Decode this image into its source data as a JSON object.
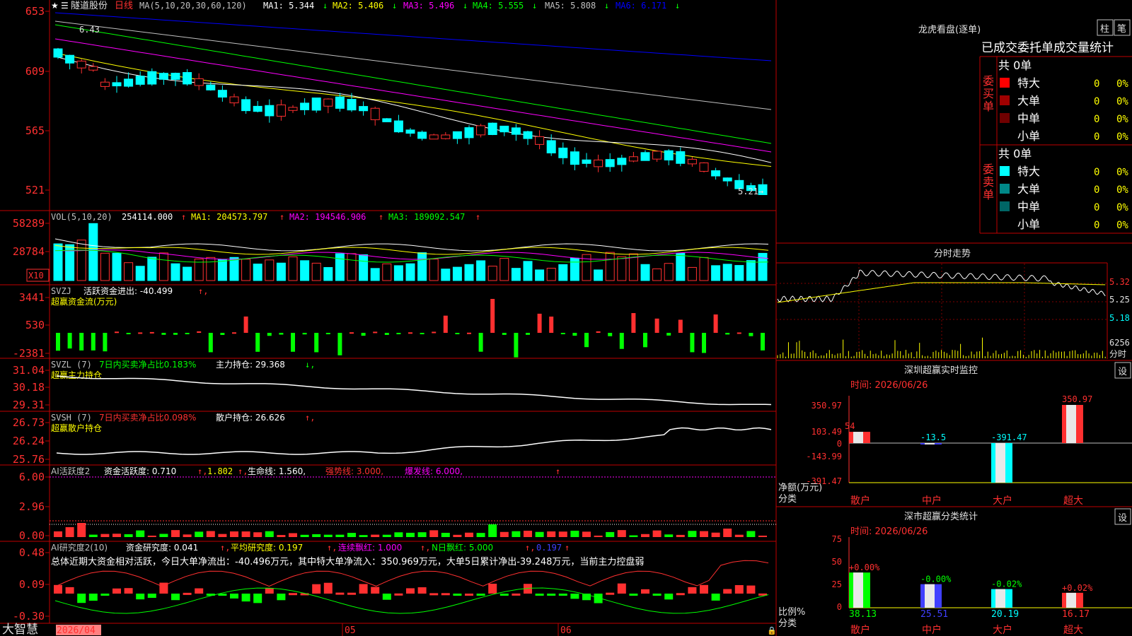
{
  "stock": {
    "name": "隧道股份",
    "period": "日线"
  },
  "main_chart": {
    "ma_params": "MA(5,10,20,30,60,120)",
    "ma": [
      {
        "label": "MA1: 5.344",
        "arrow": "↓",
        "color": "#ffffff"
      },
      {
        "label": "MA2: 5.406",
        "arrow": "↓",
        "color": "#ffff00"
      },
      {
        "label": "MA3: 5.496",
        "arrow": "↓",
        "color": "#ff00ff"
      },
      {
        "label": "MA4: 5.555",
        "arrow": "↓",
        "color": "#00ff00"
      },
      {
        "label": "MA5: 5.808",
        "arrow": "↓",
        "color": "#c0c0c0"
      },
      {
        "label": "MA6: 6.171",
        "arrow": "↓",
        "color": "#0000ff"
      }
    ],
    "y_ticks": [
      "653",
      "609",
      "565",
      "521"
    ],
    "high_marker": "6.43",
    "low_marker": "5.21→"
  },
  "vol_panel": {
    "params": "VOL(5,10,20)",
    "value": "254114.000",
    "ma1": "MA1: 204573.797",
    "ma2": "MA2: 194546.906",
    "ma3": "MA3: 189092.547",
    "y_ticks": [
      "58289",
      "28784"
    ],
    "unit": "X10"
  },
  "svzj_panel": {
    "title": "SVZJ",
    "label": "活跃资金进出: -40.499",
    "subtitle": "超赢资金流(万元)",
    "y_ticks": [
      "3441",
      "530",
      "-2381"
    ]
  },
  "svzl_panel": {
    "title": "SVZL (7)",
    "label1": "7日内买卖净占比0.183%",
    "label2": "主力持仓: 29.368",
    "subtitle": "超赢主力持仓",
    "y_ticks": [
      "31.04",
      "30.18",
      "29.31"
    ]
  },
  "svsh_panel": {
    "title": "SVSH (7)",
    "label1": "7日内买卖净占比0.098%",
    "label2": "散户持仓: 26.626",
    "subtitle": "超赢散户持仓",
    "y_ticks": [
      "26.73",
      "26.24",
      "25.76"
    ]
  },
  "ai_active_panel": {
    "title": "AI活跃度2",
    "label1": "资金活跃度: 0.710",
    "label2": "1.802",
    "label3": "生命线: 1.560,",
    "label4": "强势线: 3.000,",
    "label5": "爆发线: 6.000,",
    "y_ticks": [
      "6.00",
      "2.96",
      "0.00"
    ]
  },
  "ai_research_panel": {
    "title": "AI研究度2(10)",
    "label1": "资金研究度: 0.041",
    "label2": "平均研究度: 0.197",
    "label3": "连续飘红: 1.000",
    "label4": "N日飘红: 5.000",
    "label5": "0.197",
    "summary": "总体近期大资金相对活跃，今日大单净流出：-40.496万元，其中特大单净流入：350.969万元，大单5日累计净出-39.248万元，当前主力控盘弱",
    "y_ticks": [
      "0.48",
      "0.09",
      "-0.30"
    ]
  },
  "x_axis": {
    "labels": [
      "2026/04",
      "05",
      "06"
    ],
    "brand": "大智慧"
  },
  "right_panel": {
    "title": "龙虎看盘(逐单)",
    "btn_zhu": "柱",
    "btn_bi": "笔",
    "heading": "已成交委托单成交量统计",
    "buy_label": "委买单",
    "sell_label": "委卖单",
    "buy_total": "共 0单",
    "sell_total": "共 0单",
    "buy_rows": [
      {
        "label": "特大",
        "count": "0",
        "pct": "0%",
        "color": "#ff0000"
      },
      {
        "label": "大单",
        "count": "0",
        "pct": "0%",
        "color": "#a00000"
      },
      {
        "label": "中单",
        "count": "0",
        "pct": "0%",
        "color": "#700000"
      },
      {
        "label": "小单",
        "count": "0",
        "pct": "0%",
        "color": "#000000"
      }
    ],
    "sell_rows": [
      {
        "label": "特大",
        "count": "0",
        "pct": "0%",
        "color": "#00ffff"
      },
      {
        "label": "大单",
        "count": "0",
        "pct": "0%",
        "color": "#008888"
      },
      {
        "label": "中单",
        "count": "0",
        "pct": "0%",
        "color": "#006666"
      },
      {
        "label": "小单",
        "count": "0",
        "pct": "0%",
        "color": "#000000"
      }
    ]
  },
  "intraday": {
    "title": "分时走势",
    "y_ticks": [
      "5.32",
      "5.25",
      "5.18"
    ],
    "vol_tick": "6256",
    "vol_label": "分时"
  },
  "monitor": {
    "title": "深圳超赢实时监控",
    "btn": "设",
    "time": "时间: 2026/06/26",
    "y_ticks": [
      "350.97",
      "103.49",
      "0",
      "-143.99",
      "-391.47"
    ],
    "ylabel": "净额(万元)",
    "xlabel": "分类",
    "categories": [
      "散户",
      "中户",
      "大户",
      "超大"
    ],
    "values": [
      103.49,
      -13.5,
      -391.47,
      350.97
    ],
    "value_labels": [
      "54",
      "-13.5",
      "-391.47",
      "350.97"
    ]
  },
  "classify": {
    "title": "深市超赢分类统计",
    "btn": "设",
    "time": "时间: 2026/06/26",
    "y_ticks": [
      "75",
      "50",
      "25",
      "0"
    ],
    "ylabel": "比例%",
    "xlabel": "分类",
    "categories": [
      "散户",
      "中户",
      "大户",
      "超大"
    ],
    "values": [
      38.13,
      25.51,
      20.19,
      16.17
    ],
    "value_labels": [
      "38.13",
      "25.51",
      "20.19",
      "16.17"
    ],
    "top_labels": [
      "+0.00%",
      "-0.00%",
      "-0.02%",
      "+0.02%"
    ]
  }
}
